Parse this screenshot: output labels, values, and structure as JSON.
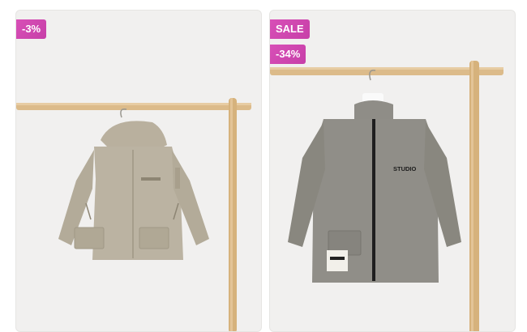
{
  "products": [
    {
      "discount_label": "-3%",
      "image_icon": "jacket-hooded-beige-icon"
    },
    {
      "sale_label": "SALE",
      "discount_label": "-34%",
      "jacket_print": "STUDIO",
      "image_icon": "jacket-zip-grey-icon"
    }
  ],
  "colors": {
    "badge": "#d84fb7",
    "card_bg": "#f1f0ef",
    "rack_wood": "#d9b784",
    "jacket_beige": "#b8b09f",
    "jacket_grey": "#8e8c86"
  }
}
